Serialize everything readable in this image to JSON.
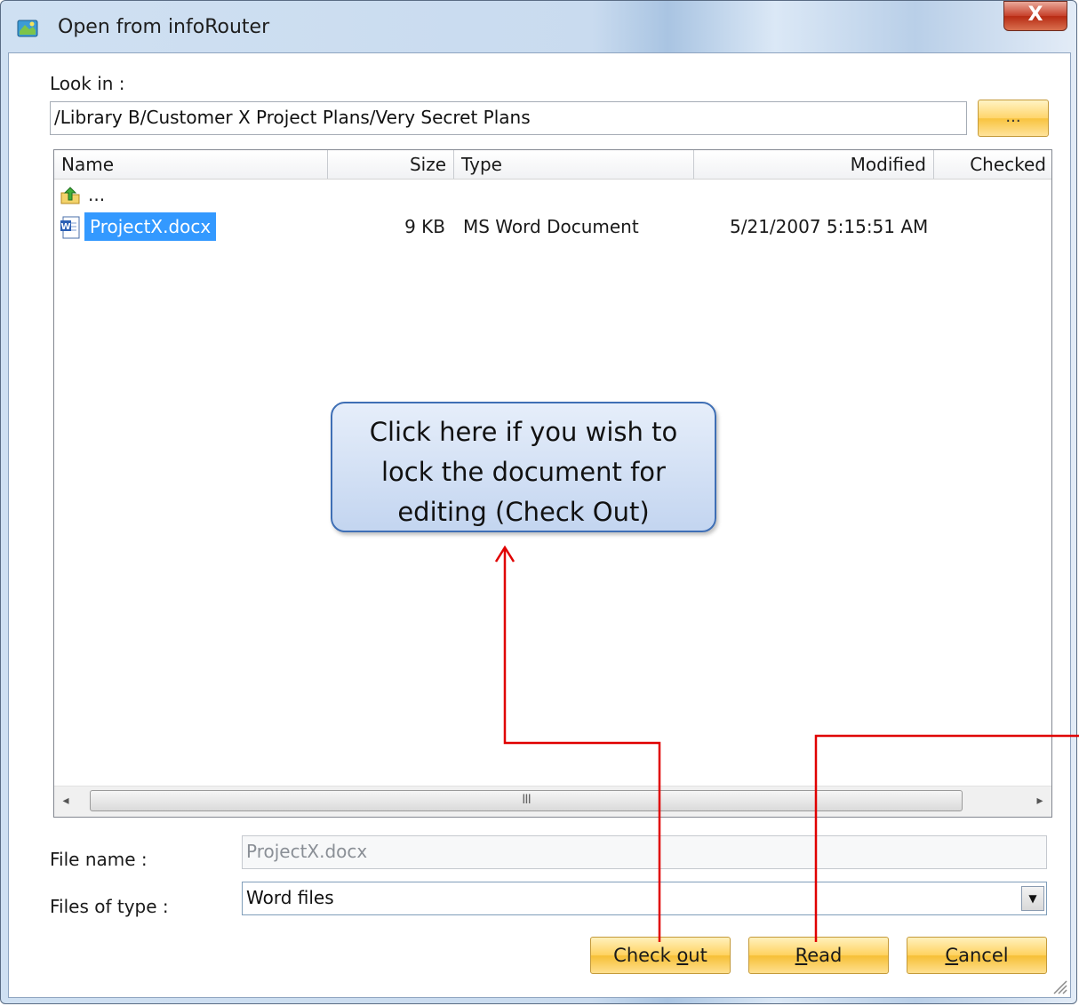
{
  "window": {
    "title": "Open from infoRouter",
    "close_glyph": "X"
  },
  "look_in": {
    "label": "Look in :",
    "path": "/Library B/Customer X Project Plans/Very Secret Plans",
    "browse_label": "..."
  },
  "columns": {
    "name": "Name",
    "size": "Size",
    "type": "Type",
    "modified": "Modified",
    "checked": "Checked"
  },
  "rows": {
    "up": {
      "label": "..."
    },
    "file": {
      "name": "ProjectX.docx",
      "size": "9 KB",
      "type": "MS Word Document",
      "modified": "5/21/2007 5:15:51 AM"
    }
  },
  "scrollbar": {
    "grip": "III",
    "left": "◂",
    "right": "▸"
  },
  "file_name": {
    "label": "File name :",
    "value": "ProjectX.docx"
  },
  "files_of_type": {
    "label": "Files of type :",
    "value": "Word files",
    "arrow": "▼"
  },
  "buttons": {
    "checkout_pre": "Check ",
    "checkout_ul": "o",
    "checkout_post": "ut",
    "read_ul": "R",
    "read_post": "ead",
    "cancel_ul": "C",
    "cancel_post": "ancel"
  },
  "annotation": {
    "text": "Click here if you wish to lock the document for editing (Check Out)"
  },
  "colors": {
    "selection": "#3399ff",
    "button": "#ffd25f",
    "arrow": "#e00000",
    "callout_border": "#3f6fb5"
  },
  "icons": {
    "app": "inforouter-app-icon",
    "up": "folder-up-icon",
    "file": "word-document-icon"
  }
}
